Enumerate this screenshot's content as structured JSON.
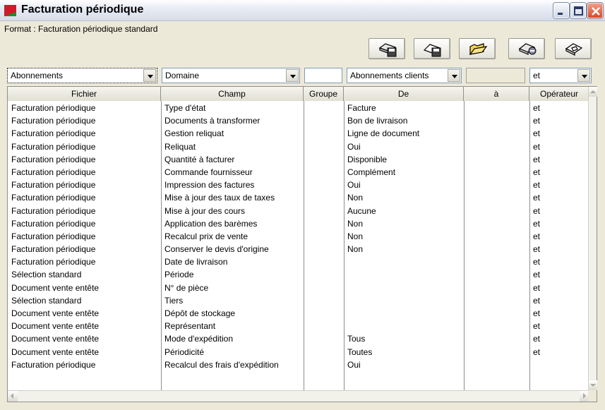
{
  "window": {
    "title": "Facturation périodique"
  },
  "format": {
    "label": "Format : Facturation périodique standard"
  },
  "toolbar": {
    "icons": [
      "save-template-icon",
      "save-icon",
      "open-folder-icon",
      "delete-template-icon",
      "print-template-icon"
    ]
  },
  "filters": {
    "fichier_select": "Abonnements",
    "champ_select": "Domaine",
    "groupe_value": "",
    "de_select": "Abonnements clients",
    "a_value": "",
    "operateur_select": "et"
  },
  "table": {
    "columns": [
      "Fichier",
      "Champ",
      "Groupe",
      "De",
      "à",
      "Opérateur"
    ],
    "rows": [
      {
        "fichier": "Facturation périodique",
        "champ": "Type d'état",
        "groupe": "",
        "de": "Facture",
        "a": "",
        "operateur": "et"
      },
      {
        "fichier": "Facturation périodique",
        "champ": "Documents à transformer",
        "groupe": "",
        "de": "Bon de livraison",
        "a": "",
        "operateur": "et"
      },
      {
        "fichier": "Facturation périodique",
        "champ": "Gestion reliquat",
        "groupe": "",
        "de": "Ligne de document",
        "a": "",
        "operateur": "et"
      },
      {
        "fichier": "Facturation périodique",
        "champ": "Reliquat",
        "groupe": "",
        "de": "Oui",
        "a": "",
        "operateur": "et"
      },
      {
        "fichier": "Facturation périodique",
        "champ": "Quantité à facturer",
        "groupe": "",
        "de": "Disponible",
        "a": "",
        "operateur": "et"
      },
      {
        "fichier": "Facturation périodique",
        "champ": "Commande fournisseur",
        "groupe": "",
        "de": "Complément",
        "a": "",
        "operateur": "et"
      },
      {
        "fichier": "Facturation périodique",
        "champ": "Impression des factures",
        "groupe": "",
        "de": "Oui",
        "a": "",
        "operateur": "et"
      },
      {
        "fichier": "Facturation périodique",
        "champ": "Mise à jour des taux de taxes",
        "groupe": "",
        "de": "Non",
        "a": "",
        "operateur": "et"
      },
      {
        "fichier": "Facturation périodique",
        "champ": "Mise à jour des cours",
        "groupe": "",
        "de": "Aucune",
        "a": "",
        "operateur": "et"
      },
      {
        "fichier": "Facturation périodique",
        "champ": "Application des barèmes",
        "groupe": "",
        "de": "Non",
        "a": "",
        "operateur": "et"
      },
      {
        "fichier": "Facturation périodique",
        "champ": "Recalcul prix de vente",
        "groupe": "",
        "de": "Non",
        "a": "",
        "operateur": "et"
      },
      {
        "fichier": "Facturation périodique",
        "champ": "Conserver le devis d'origine",
        "groupe": "",
        "de": "Non",
        "a": "",
        "operateur": "et"
      },
      {
        "fichier": "Facturation périodique",
        "champ": "Date de livraison",
        "groupe": "",
        "de": "",
        "a": "",
        "operateur": "et"
      },
      {
        "fichier": "Sélection standard",
        "champ": "Période",
        "groupe": "",
        "de": "",
        "a": "",
        "operateur": "et"
      },
      {
        "fichier": "Document vente entête",
        "champ": "N° de pièce",
        "groupe": "",
        "de": "",
        "a": "",
        "operateur": "et"
      },
      {
        "fichier": "Sélection standard",
        "champ": "Tiers",
        "groupe": "",
        "de": "",
        "a": "",
        "operateur": "et"
      },
      {
        "fichier": "Document vente entête",
        "champ": "Dépôt de stockage",
        "groupe": "",
        "de": "",
        "a": "",
        "operateur": "et"
      },
      {
        "fichier": "Document vente entête",
        "champ": "Représentant",
        "groupe": "",
        "de": "",
        "a": "",
        "operateur": "et"
      },
      {
        "fichier": "Document vente entête",
        "champ": "Mode d'expédition",
        "groupe": "",
        "de": "Tous",
        "a": "",
        "operateur": "et"
      },
      {
        "fichier": "Document vente entête",
        "champ": "Périodicité",
        "groupe": "",
        "de": "Toutes",
        "a": "",
        "operateur": "et"
      },
      {
        "fichier": "Facturation périodique",
        "champ": "Recalcul des frais d'expédition",
        "groupe": "",
        "de": "Oui",
        "a": "",
        "operateur": ""
      }
    ]
  }
}
